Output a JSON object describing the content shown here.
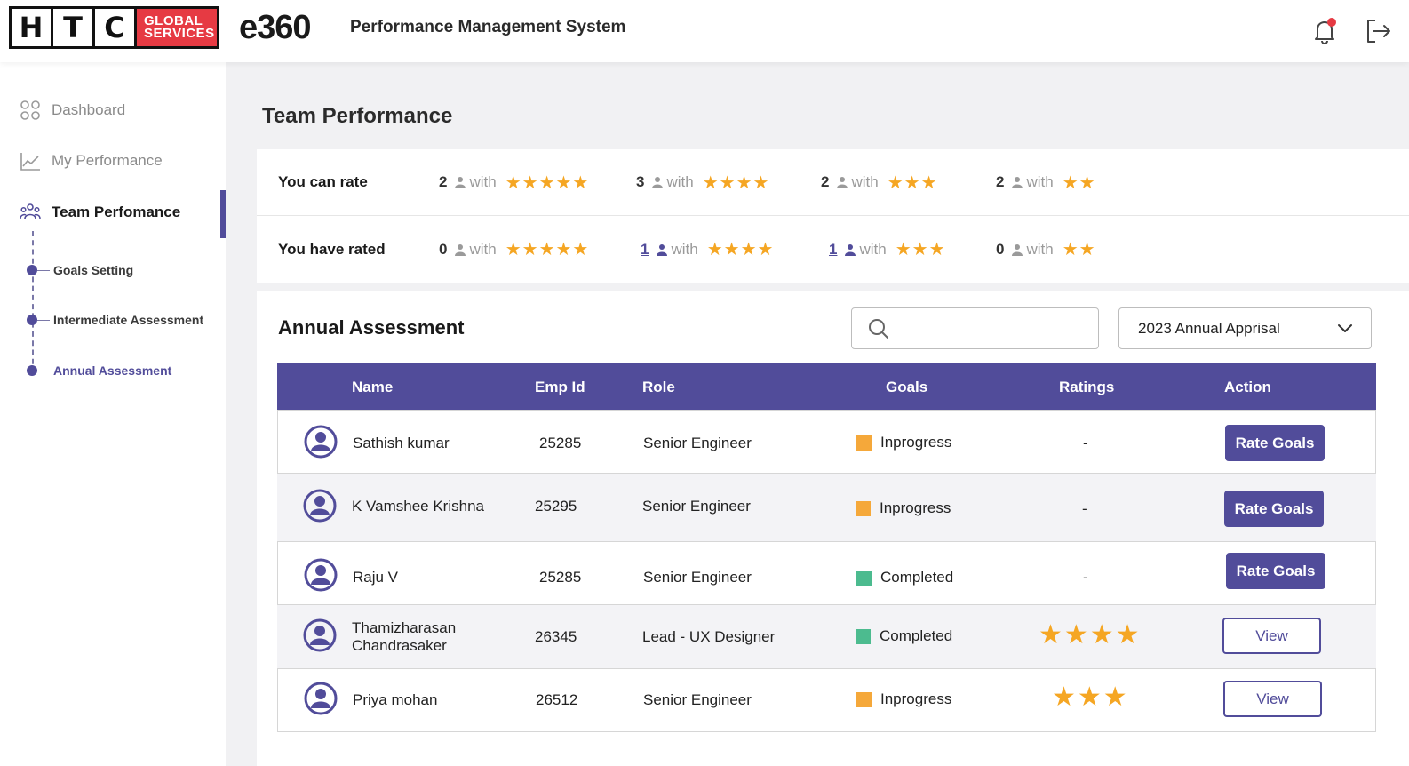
{
  "header": {
    "logo_letters": [
      "H",
      "T",
      "C"
    ],
    "logo_badge_line1": "GLOBAL",
    "logo_badge_line2": "SERVICES",
    "brand": "e360",
    "tagline": "Performance Management System",
    "icons": [
      "bell-icon",
      "logout-icon"
    ],
    "notification_color": "#e63a43"
  },
  "sidebar": {
    "items": [
      {
        "label": "Dashboard",
        "icon": "grid-icon"
      },
      {
        "label": "My Performance",
        "icon": "chart-icon"
      },
      {
        "label": "Team Perfomance",
        "icon": "team-icon"
      }
    ],
    "sub_items": [
      {
        "label": "Goals Setting"
      },
      {
        "label": "Intermediate Assessment"
      },
      {
        "label": "Annual Assessment"
      }
    ]
  },
  "main": {
    "page_title": "Team Performance",
    "rating_summary": {
      "rows": [
        {
          "label": "You can rate",
          "groups": [
            {
              "count": "2",
              "with": "with",
              "stars": "★★★★★"
            },
            {
              "count": "3",
              "with": "with",
              "stars": "★★★★"
            },
            {
              "count": "2",
              "with": "with",
              "stars": "★★★"
            },
            {
              "count": "2",
              "with": "with",
              "stars": "★★"
            }
          ]
        },
        {
          "label": "You have rated",
          "groups": [
            {
              "count": "0",
              "with": "with",
              "stars": "★★★★★"
            },
            {
              "count": "1",
              "with": "with",
              "stars": "★★★★"
            },
            {
              "count": "1",
              "with": "with",
              "stars": "★★★"
            },
            {
              "count": "0",
              "with": "with",
              "stars": "★★"
            }
          ]
        }
      ]
    },
    "assessment": {
      "title": "Annual Assessment",
      "search_placeholder": "",
      "selected_period": "2023 Annual Apprisal",
      "columns": [
        "Name",
        "Emp Id",
        "Role",
        "Goals",
        "Ratings",
        "Action"
      ],
      "rows": [
        {
          "name": "Sathish kumar",
          "emp_id": "25285",
          "role": "Senior Engineer",
          "goal_status": "Inprogress",
          "status_color": "#f5a83a",
          "rating": "-",
          "action": "Rate Goals"
        },
        {
          "name": "K Vamshee Krishna",
          "emp_id": "25295",
          "role": "Senior Engineer",
          "goal_status": "Inprogress",
          "status_color": "#f5a83a",
          "rating": "-",
          "action": "Rate Goals"
        },
        {
          "name": "Raju V",
          "emp_id": "25285",
          "role": "Senior Engineer",
          "goal_status": "Completed",
          "status_color": "#4cbb8f",
          "rating": "-",
          "action": "Rate Goals"
        },
        {
          "name_line1": "Thamizharasan",
          "name_line2": "Chandrasaker",
          "emp_id": "26345",
          "role": "Lead - UX Designer",
          "goal_status": "Completed",
          "status_color": "#4cbb8f",
          "rating_stars": "★★★★",
          "action": "View"
        },
        {
          "name": "Priya mohan",
          "emp_id": "26512",
          "role": "Senior Engineer",
          "goal_status": "Inprogress",
          "status_color": "#f5a83a",
          "rating_stars": "★★★",
          "action": "View"
        }
      ]
    }
  },
  "colors": {
    "primary": "#514c9a",
    "star": "#f5a623",
    "brand_red": "#e63a43"
  }
}
